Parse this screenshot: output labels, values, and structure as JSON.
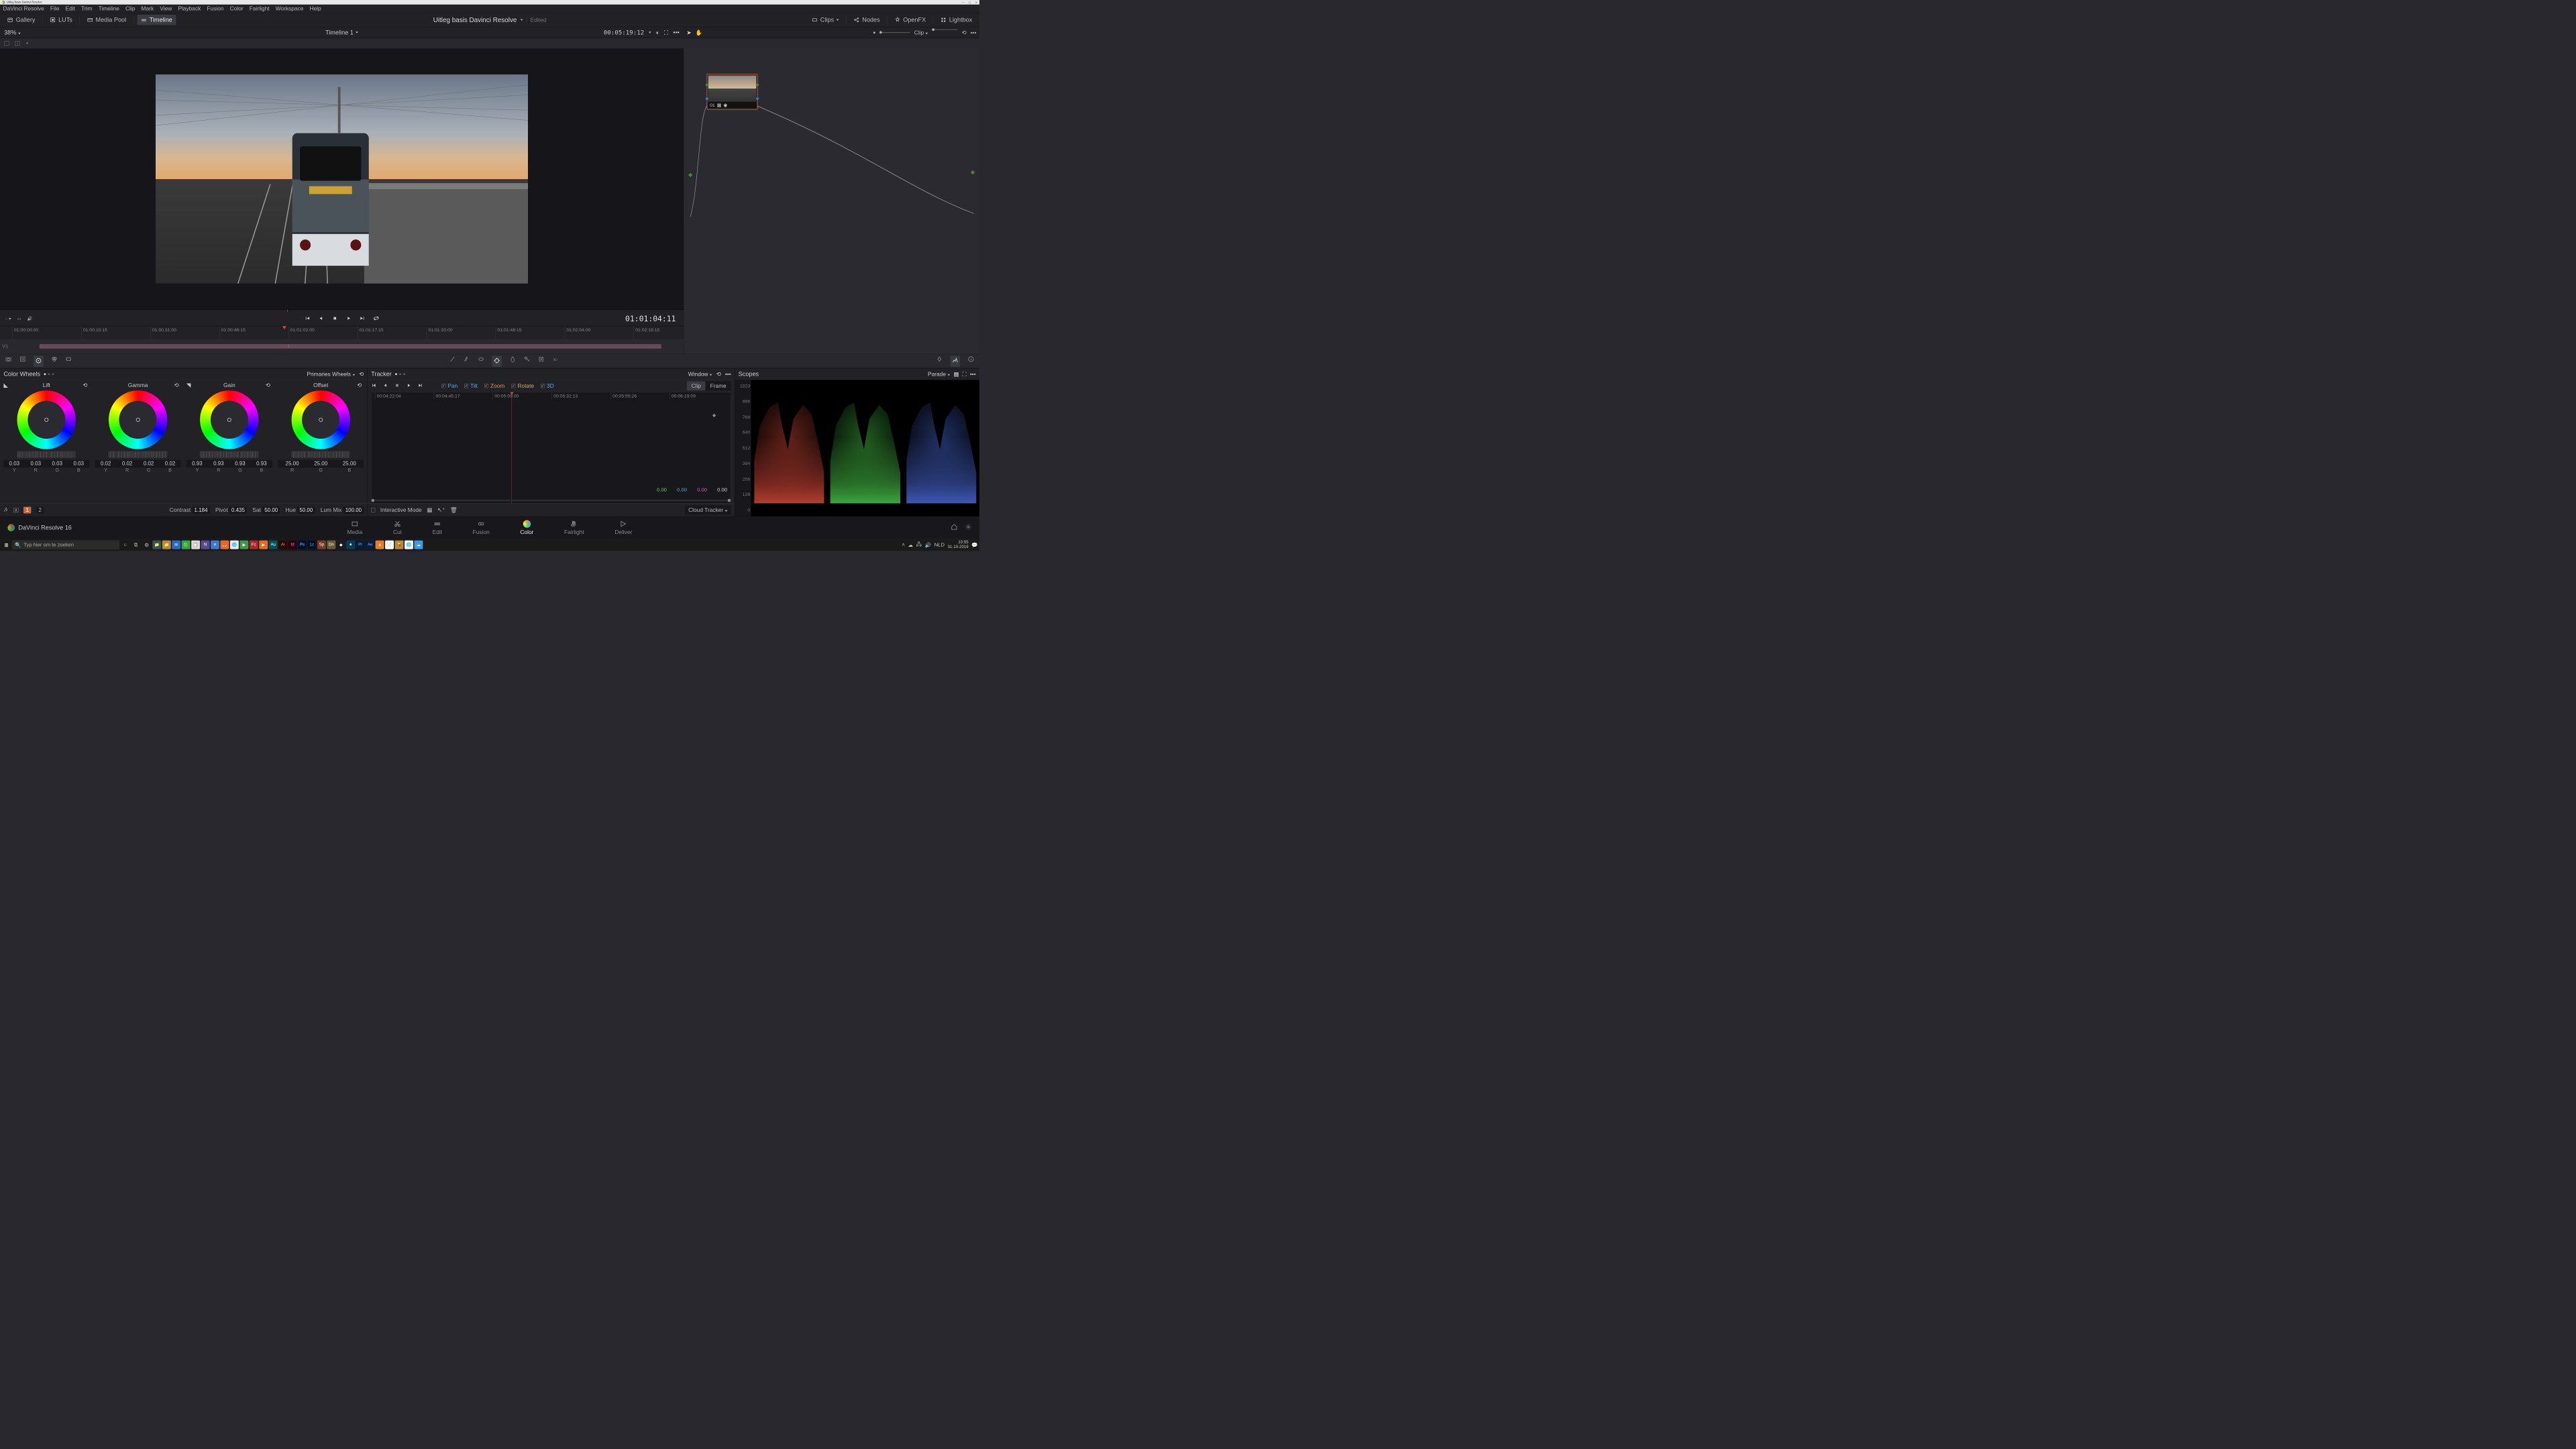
{
  "window_title": "Uitleg basis Davinci Resolve",
  "menubar": [
    "DaVinci Resolve",
    "File",
    "Edit",
    "Trim",
    "Timeline",
    "Clip",
    "Mark",
    "View",
    "Playback",
    "Fusion",
    "Color",
    "Fairlight",
    "Workspace",
    "Help"
  ],
  "toolbar": {
    "left": [
      {
        "name": "gallery",
        "label": "Gallery",
        "active": false
      },
      {
        "name": "luts",
        "label": "LUTs",
        "active": false
      },
      {
        "name": "mediapool",
        "label": "Media Pool",
        "active": false
      },
      {
        "name": "timeline",
        "label": "Timeline",
        "active": true
      }
    ],
    "project_title": "Uitleg basis Davinci Resolve",
    "edited": "Edited",
    "right": [
      {
        "name": "clips",
        "label": "Clips"
      },
      {
        "name": "nodes",
        "label": "Nodes"
      },
      {
        "name": "openfx",
        "label": "OpenFX"
      },
      {
        "name": "lightbox",
        "label": "Lightbox"
      }
    ]
  },
  "timeline_header": {
    "zoom": "38%",
    "name": "Timeline 1",
    "timecode": "00:05:19:12"
  },
  "node_header": {
    "mode": "Clip"
  },
  "node": {
    "label": "01"
  },
  "transport_tc": "01:01:04:11",
  "clip_ruler": [
    "01:00:00:00",
    "01:00:15:15",
    "01:00:31:00",
    "01:00:46:15",
    "01:01:02:00",
    "01:01:17:15",
    "01:01:33:00",
    "01:01:48:15",
    "01:02:04:00",
    "01:02:19:15"
  ],
  "track_label": "V1",
  "color_wheels": {
    "title": "Color Wheels",
    "mode": "Primaries Wheels",
    "wheels": [
      {
        "name": "Lift",
        "y": "0.03",
        "r": "0.03",
        "g": "0.03",
        "b": "0.03"
      },
      {
        "name": "Gamma",
        "y": "0.02",
        "r": "0.02",
        "g": "0.02",
        "b": "0.02"
      },
      {
        "name": "Gain",
        "y": "0.93",
        "r": "0.93",
        "g": "0.93",
        "b": "0.93"
      },
      {
        "name": "Offset",
        "r": "25.00",
        "g": "25.00",
        "b": "25.00"
      }
    ],
    "footer": {
      "page_active": "1",
      "page_other": "2",
      "contrast_l": "Contrast",
      "contrast": "1.184",
      "pivot_l": "Pivot",
      "pivot": "0.435",
      "sat_l": "Sat",
      "sat": "50.00",
      "hue_l": "Hue",
      "hue": "50.00",
      "lummix_l": "Lum Mix",
      "lummix": "100.00"
    }
  },
  "tracker": {
    "title": "Tracker",
    "mode": "Window",
    "tracks": [
      {
        "n": "Pan",
        "c": "c-pan"
      },
      {
        "n": "Tilt",
        "c": "c-tilt"
      },
      {
        "n": "Zoom",
        "c": "c-zoom"
      },
      {
        "n": "Rotate",
        "c": "c-rotate"
      },
      {
        "n": "3D",
        "c": "c-3d"
      }
    ],
    "seg": [
      "Clip",
      "Frame"
    ],
    "seg_active": 0,
    "ticks": [
      "00:04:22:04",
      "00:04:45:17",
      "00:05:09:00",
      "00:05:32:13",
      "00:05:55:26",
      "00:06:19:09"
    ],
    "vals": [
      "0.00",
      "0.00",
      "0.00",
      "0.00"
    ],
    "interactive": "Interactive Mode",
    "cloud": "Cloud Tracker"
  },
  "scopes": {
    "title": "Scopes",
    "mode": "Parade",
    "ylabels": [
      "1023",
      "896",
      "768",
      "640",
      "512",
      "384",
      "256",
      "128",
      "0"
    ]
  },
  "pages": [
    "Media",
    "Cut",
    "Edit",
    "Fusion",
    "Color",
    "Fairlight",
    "Deliver"
  ],
  "brand": "DaVinci Resolve 16",
  "taskbar": {
    "search_ph": "Typ hier om te zoeken",
    "time": "10:55",
    "date": "31-10-2019"
  }
}
